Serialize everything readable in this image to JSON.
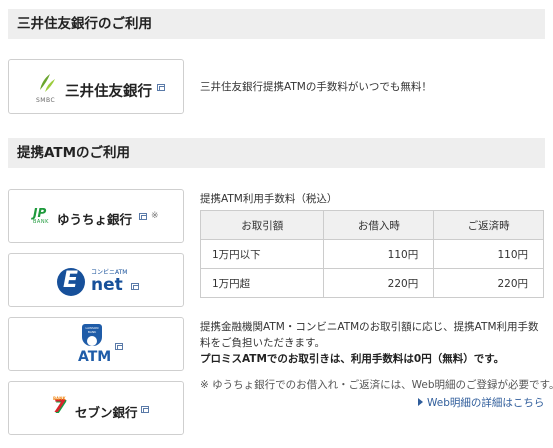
{
  "section1": {
    "title": "三井住友銀行のご利用",
    "card": {
      "logo_sub": "SMBC",
      "name": "三井住友銀行"
    },
    "note": "三井住友銀行提携ATMの手数料がいつでも無料！"
  },
  "section2": {
    "title": "提携ATMのご利用",
    "cards": [
      {
        "mark": "JP",
        "mark_sub": "BANK",
        "name": "ゆうちょ銀行",
        "note": "※"
      },
      {
        "mark": "E",
        "caption": "コンビニATM",
        "name": "net"
      },
      {
        "badge": "LAWSON BANK",
        "name": "ATM"
      },
      {
        "mark": "7",
        "mark_sub": "BANK",
        "name": "セブン銀行"
      }
    ],
    "table_caption": "提携ATM利用手数料（税込）",
    "table": {
      "headers": [
        "お取引額",
        "お借入時",
        "ご返済時"
      ],
      "rows": [
        [
          "1万円以下",
          "110円",
          "110円"
        ],
        [
          "1万円超",
          "220円",
          "220円"
        ]
      ]
    },
    "notes": [
      "提携金融機関ATM・コンビニATMのお取引額に応じ、提携ATM利用手数",
      "料をご負担いただきます。"
    ],
    "bold_note": "プロミスATMでのお取引きは、利用手数料は0円（無料）です。",
    "footnote": "※ ゆうちょ銀行でのお借入れ・ご返済には、Web明細のご登録が必要です。",
    "link": "Web明細の詳細はこちら"
  },
  "colors": {
    "smbc_green": "#6aa52e",
    "jp_green": "#1e9a3c",
    "enet_blue": "#17509a",
    "lawson_blue": "#1f5ca8",
    "seven_red": "#d8262c",
    "seven_orange": "#f08c1e",
    "seven_green": "#169c46",
    "link_blue": "#2f5d9b"
  }
}
